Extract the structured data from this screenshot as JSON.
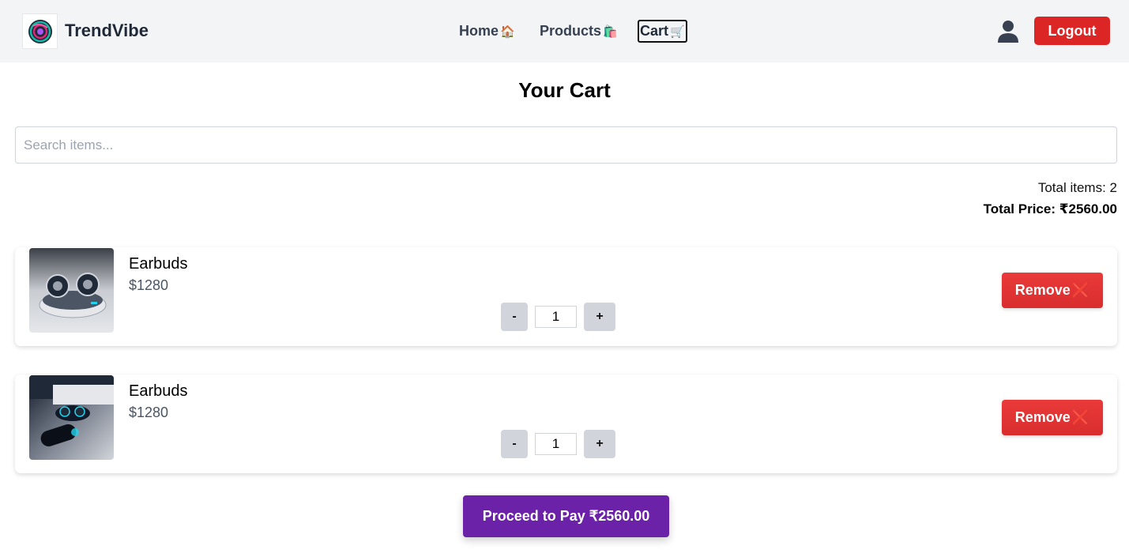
{
  "header": {
    "brand": "TrendVibe",
    "nav": [
      {
        "label": "Home",
        "emoji": "🏠"
      },
      {
        "label": "Products",
        "emoji": "🛍️"
      },
      {
        "label": "Cart",
        "emoji": "🛒"
      }
    ],
    "user_icon": "user-icon",
    "logout_label": "Logout"
  },
  "page": {
    "title": "Your Cart"
  },
  "search": {
    "placeholder": "Search items...",
    "value": ""
  },
  "totals": {
    "items_text": "Total items: 2",
    "price_text": "Total Price: ₹2560.00"
  },
  "items": [
    {
      "name": "Earbuds",
      "price": "$1280",
      "quantity": "1",
      "minus_label": "-",
      "plus_label": "+",
      "remove_label": "Remove",
      "remove_icon": "❌"
    },
    {
      "name": "Earbuds",
      "price": "$1280",
      "quantity": "1",
      "minus_label": "-",
      "plus_label": "+",
      "remove_label": "Remove",
      "remove_icon": "❌"
    }
  ],
  "checkout": {
    "proceed_label": "Proceed to Pay ₹2560.00"
  },
  "colors": {
    "header_bg": "#f3f4f6",
    "logout": "#dc2626",
    "remove": "#e53535",
    "proceed": "#6b21a8"
  }
}
